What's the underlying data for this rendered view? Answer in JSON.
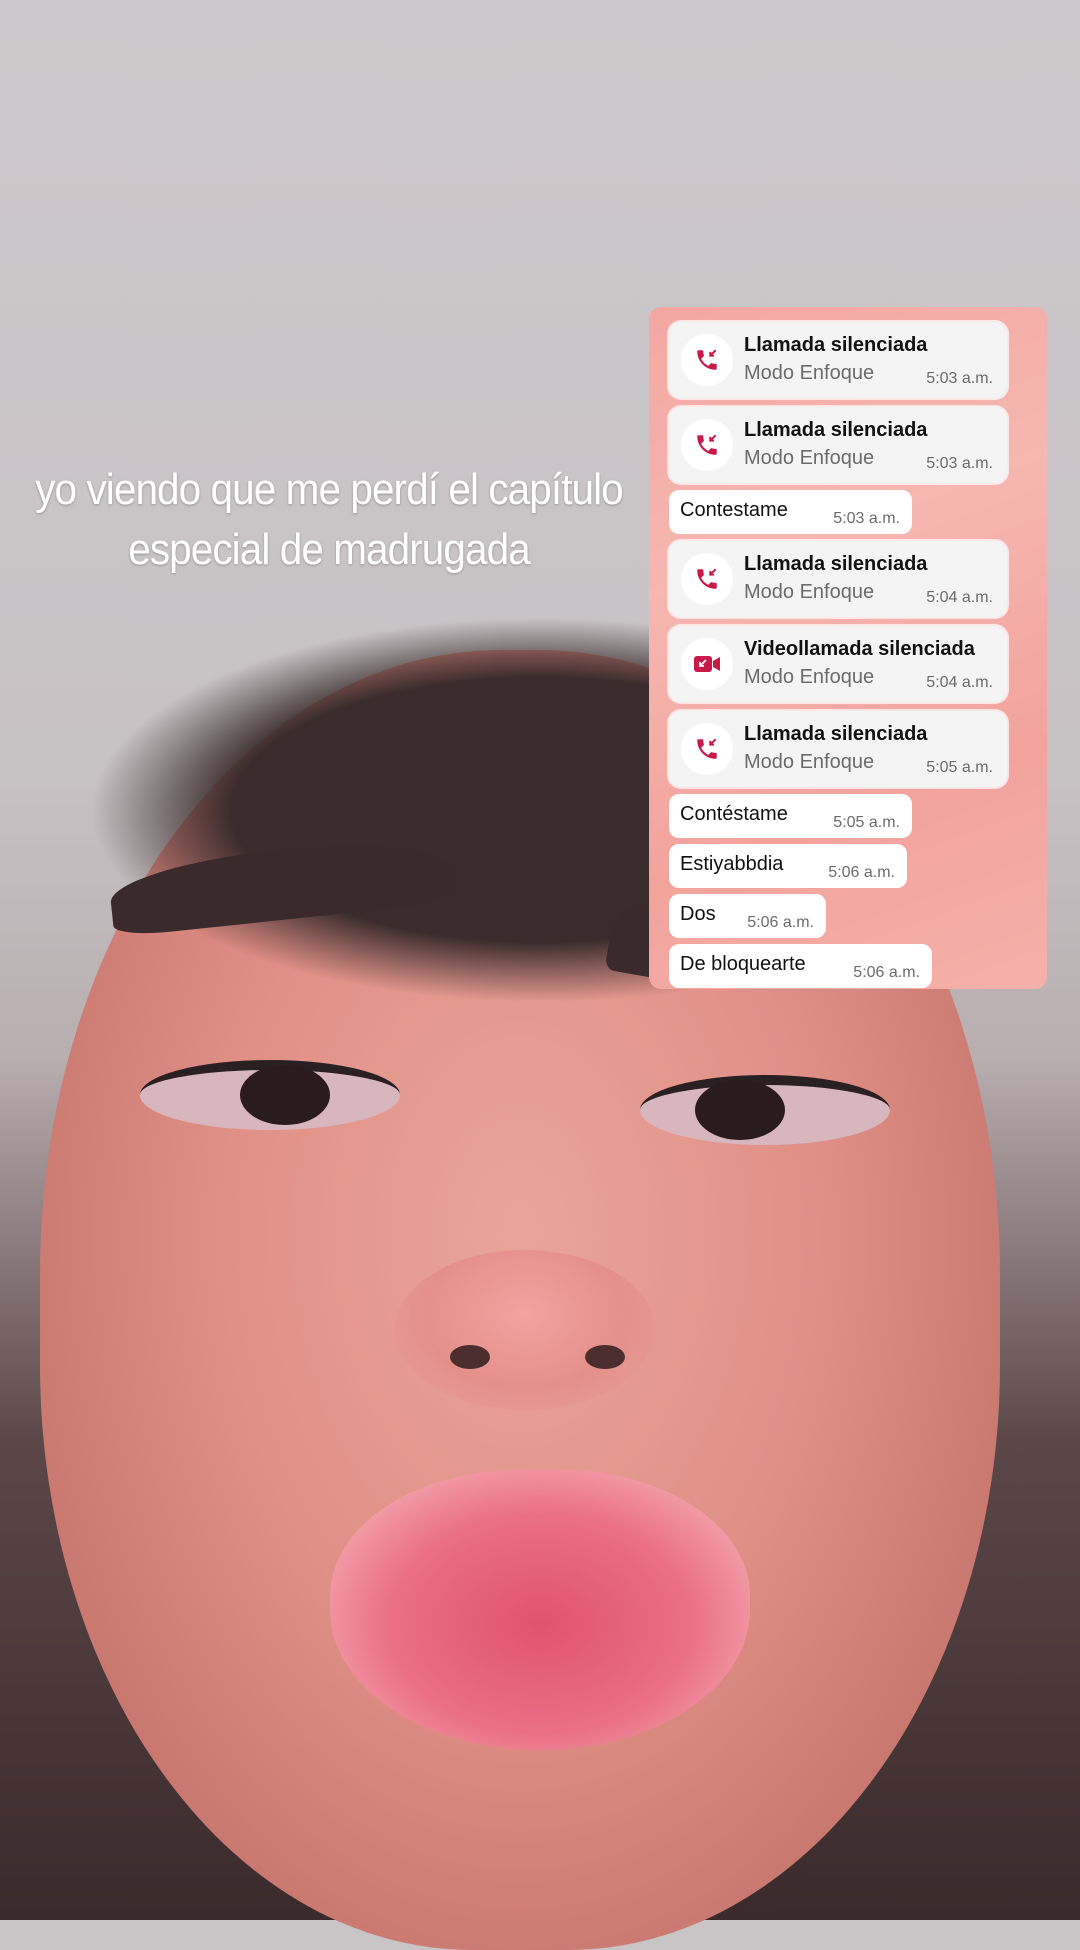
{
  "caption": {
    "line1": "yo viendo que me perdí el capítulo",
    "line2": "especial de madrugada"
  },
  "colors": {
    "accent_icon": "#c8194b",
    "panel_bg": "#f4aca6",
    "card_bg": "#f4f4f5",
    "bubble_bg": "#ffffff"
  },
  "messages": [
    {
      "kind": "call",
      "icon": "missed-call-icon",
      "title": "Llamada silenciada",
      "subtitle": "Modo Enfoque",
      "time": "5:03 a.m."
    },
    {
      "kind": "call",
      "icon": "missed-call-icon",
      "title": "Llamada silenciada",
      "subtitle": "Modo Enfoque",
      "time": "5:03 a.m."
    },
    {
      "kind": "text",
      "text": "Contestame",
      "time": "5:03 a.m."
    },
    {
      "kind": "call",
      "icon": "missed-call-icon",
      "title": "Llamada silenciada",
      "subtitle": "Modo Enfoque",
      "time": "5:04 a.m."
    },
    {
      "kind": "call",
      "icon": "video-call-icon",
      "title": "Videollamada silenciada",
      "subtitle": "Modo Enfoque",
      "time": "5:04 a.m."
    },
    {
      "kind": "call",
      "icon": "missed-call-icon",
      "title": "Llamada silenciada",
      "subtitle": "Modo Enfoque",
      "time": "5:05 a.m."
    },
    {
      "kind": "text",
      "text": "Contéstame",
      "time": "5:05 a.m."
    },
    {
      "kind": "text",
      "text": "Estiyabbdia",
      "time": "5:06 a.m."
    },
    {
      "kind": "text",
      "text": "Dos",
      "time": "5:06 a.m."
    },
    {
      "kind": "text",
      "text": "De bloquearte",
      "time": "5:06 a.m."
    }
  ]
}
